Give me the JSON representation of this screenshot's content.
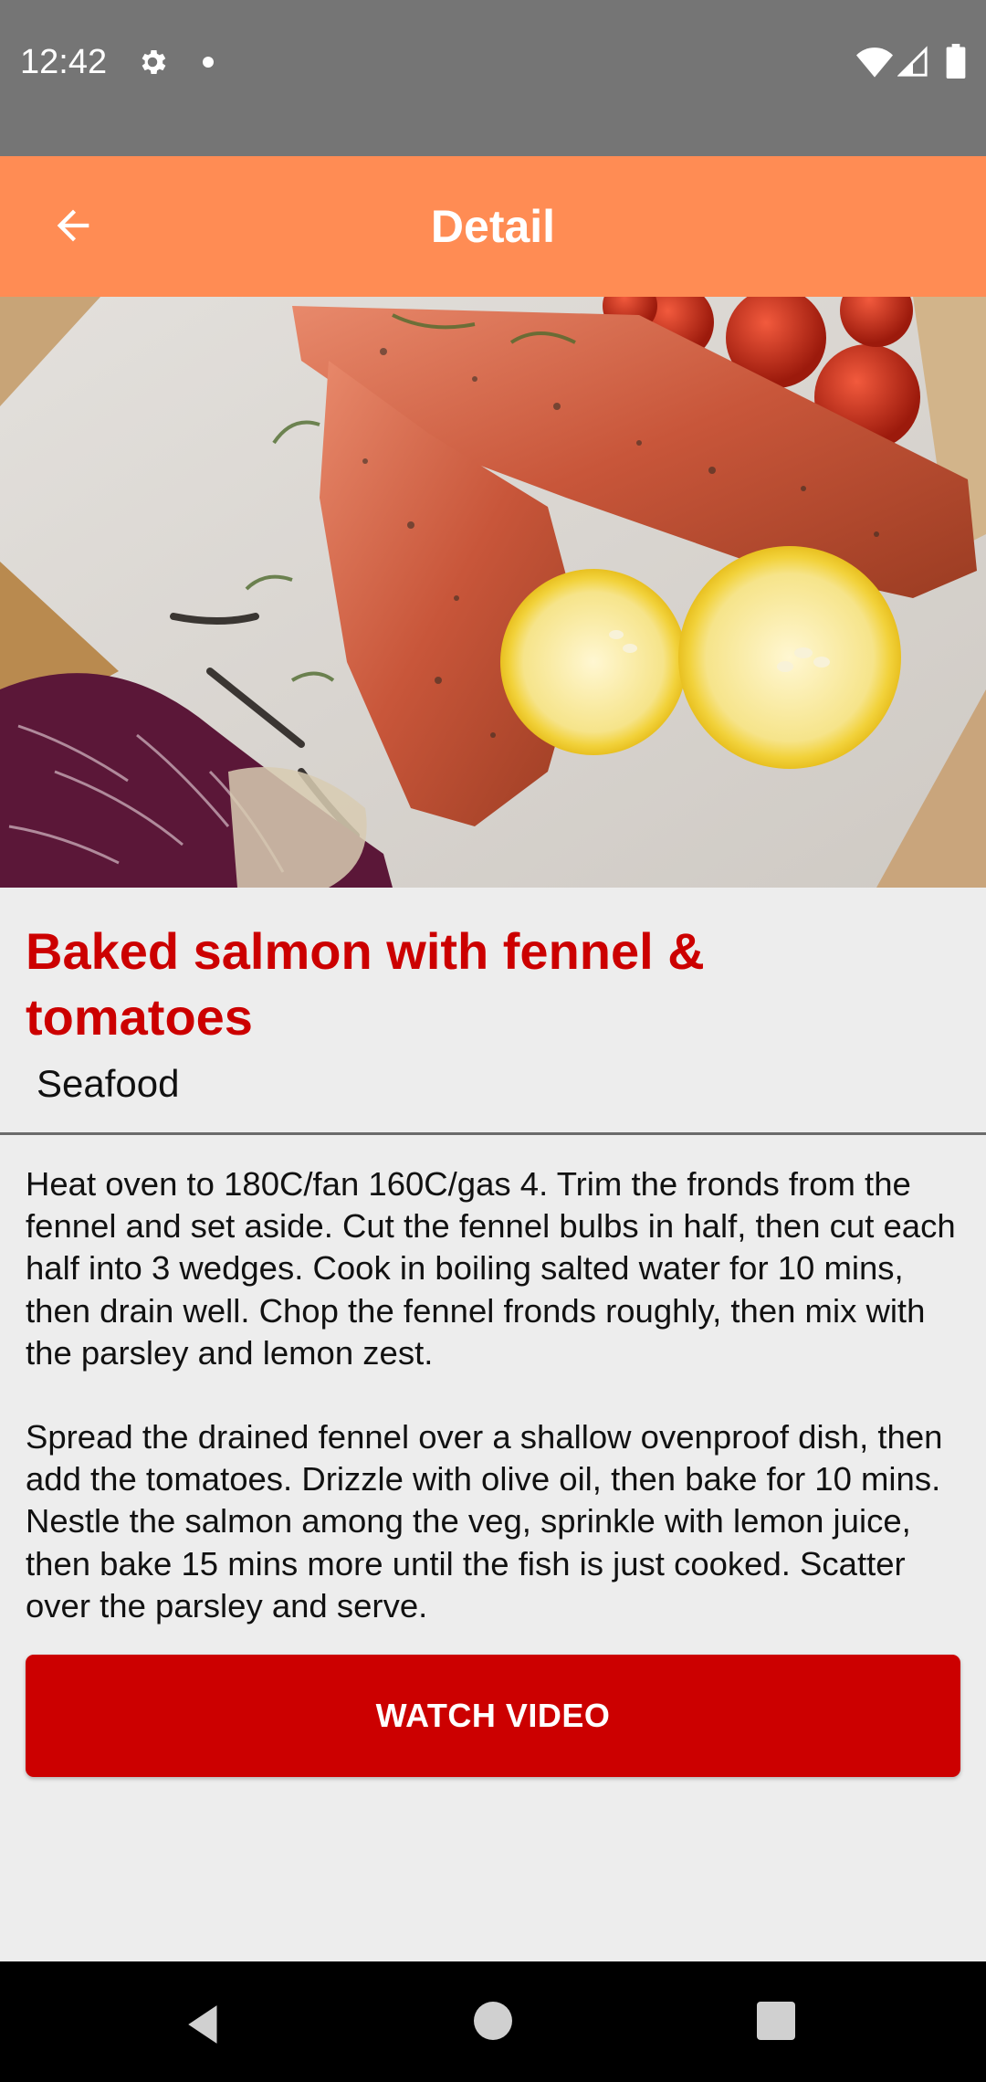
{
  "status_bar": {
    "time": "12:42",
    "icons": [
      "gear-icon",
      "notification-dot-icon",
      "wifi-icon",
      "cell-signal-icon",
      "battery-icon"
    ]
  },
  "app_bar": {
    "title": "Detail",
    "back_icon": "arrow-back-icon",
    "background_color": "#ff8c54"
  },
  "recipe": {
    "title": "Baked salmon with fennel & tomatoes",
    "category": "Seafood",
    "instructions": [
      "Heat oven to 180C/fan 160C/gas 4. Trim the fronds from the fennel and set aside. Cut the fennel bulbs in half, then cut each half into 3 wedges. Cook in boiling salted water for 10 mins, then drain well. Chop the fennel fronds roughly, then mix with the parsley and lemon zest.",
      "Spread the drained fennel over a shallow ovenproof dish, then add the tomatoes. Drizzle with olive oil, then bake for 10 mins. Nestle the salmon among the veg, sprinkle with lemon juice, then bake 15 mins more until the fish is just cooked. Scatter over the parsley and serve."
    ],
    "title_color": "#cc0000"
  },
  "actions": {
    "watch_video_label": "WATCH VIDEO",
    "button_color": "#cc0000"
  },
  "nav_bar": {
    "icons": [
      "nav-back-icon",
      "nav-home-icon",
      "nav-recents-icon"
    ]
  }
}
